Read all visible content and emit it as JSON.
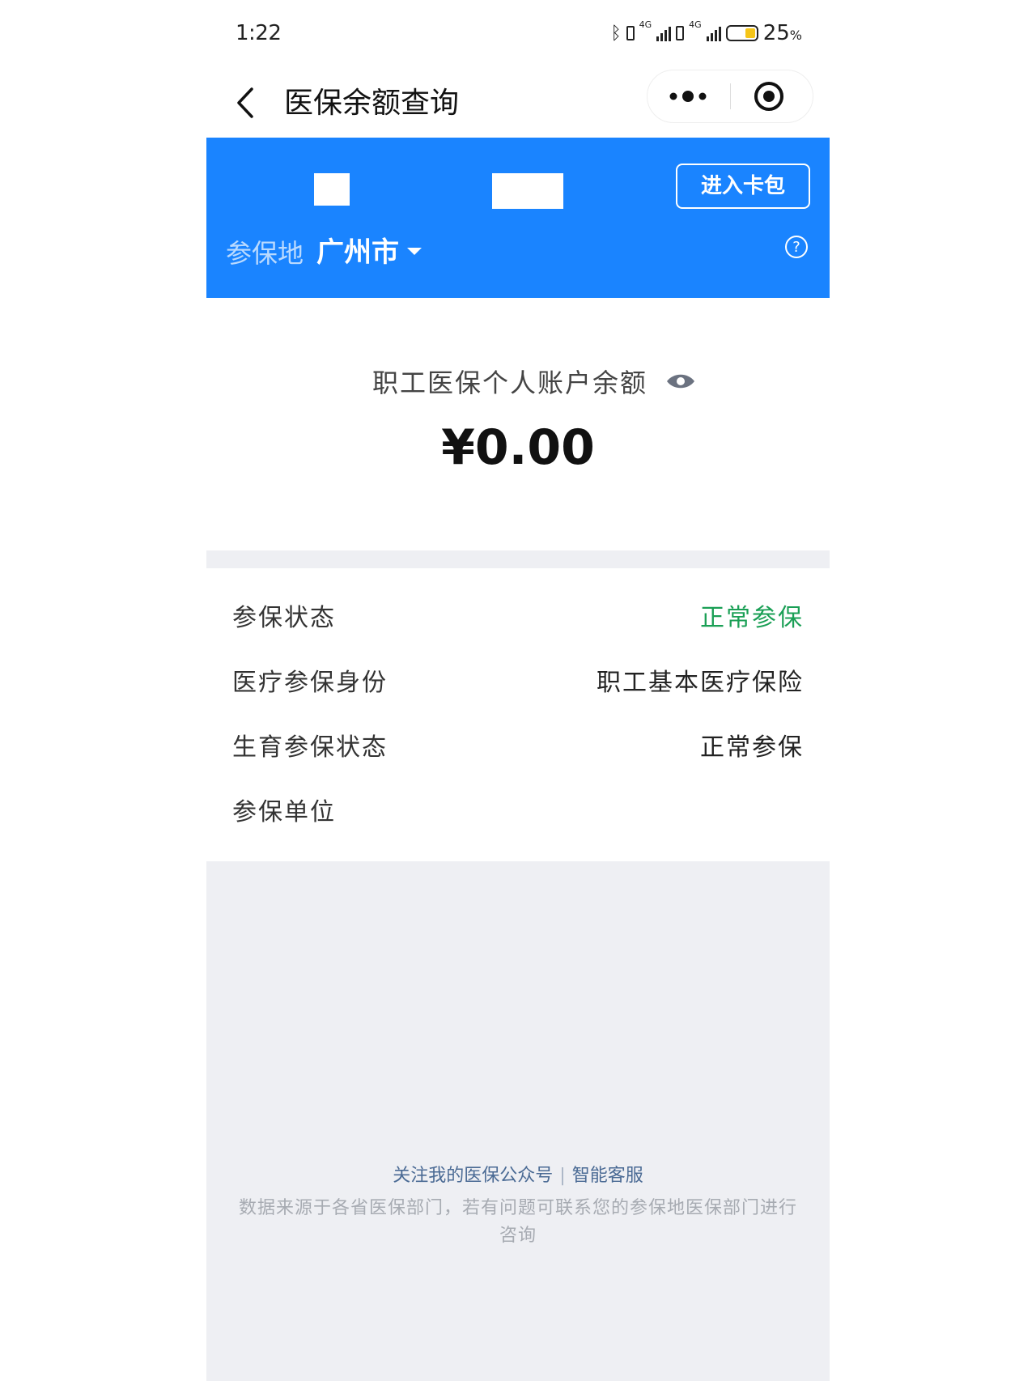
{
  "status_bar": {
    "time": "1:22",
    "network_1": "4G",
    "network_2": "4G",
    "battery_percent": "25",
    "battery_unit": "%"
  },
  "nav": {
    "title": "医保余额查询"
  },
  "header": {
    "wallet_button": "进入卡包",
    "region_label": "参保地",
    "region_value": "广州市",
    "accent_color": "#1a84ff"
  },
  "balance": {
    "label": "职工医保个人账户余额",
    "amount": "¥0.00"
  },
  "info": [
    {
      "label": "参保状态",
      "value": "正常参保",
      "value_color": "#1a9f55"
    },
    {
      "label": "医疗参保身份",
      "value": "职工基本医疗保险"
    },
    {
      "label": "生育参保状态",
      "value": "正常参保"
    },
    {
      "label": "参保单位",
      "value": ""
    }
  ],
  "footer": {
    "link_follow": "关注我的医保公众号",
    "link_service": "智能客服",
    "note": "数据来源于各省医保部门，若有问题可联系您的参保地医保部门进行咨询"
  }
}
